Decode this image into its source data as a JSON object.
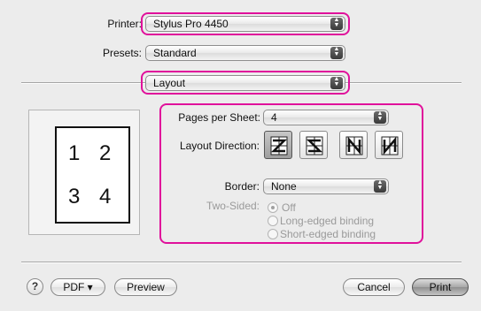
{
  "printer": {
    "label": "Printer:",
    "value": "Stylus Pro 4450"
  },
  "presets": {
    "label": "Presets:",
    "value": "Standard"
  },
  "panel": {
    "value": "Layout"
  },
  "layout": {
    "pages_per_sheet": {
      "label": "Pages per Sheet:",
      "value": "4"
    },
    "layout_direction": {
      "label": "Layout Direction:",
      "selected_index": 0
    },
    "border": {
      "label": "Border:",
      "value": "None"
    },
    "two_sided": {
      "label": "Two-Sided:",
      "options": [
        "Off",
        "Long-edged binding",
        "Short-edged binding"
      ],
      "selected": "Off",
      "enabled": false
    }
  },
  "preview": {
    "pages": [
      "1",
      "2",
      "3",
      "4"
    ]
  },
  "buttons": {
    "help": "?",
    "pdf": "PDF ▾",
    "preview": "Preview",
    "cancel": "Cancel",
    "print": "Print"
  },
  "colors": {
    "highlight": "#e0119b"
  },
  "icons": {
    "popup_arrows": "up-down-arrows-icon",
    "help": "question-mark-icon"
  }
}
